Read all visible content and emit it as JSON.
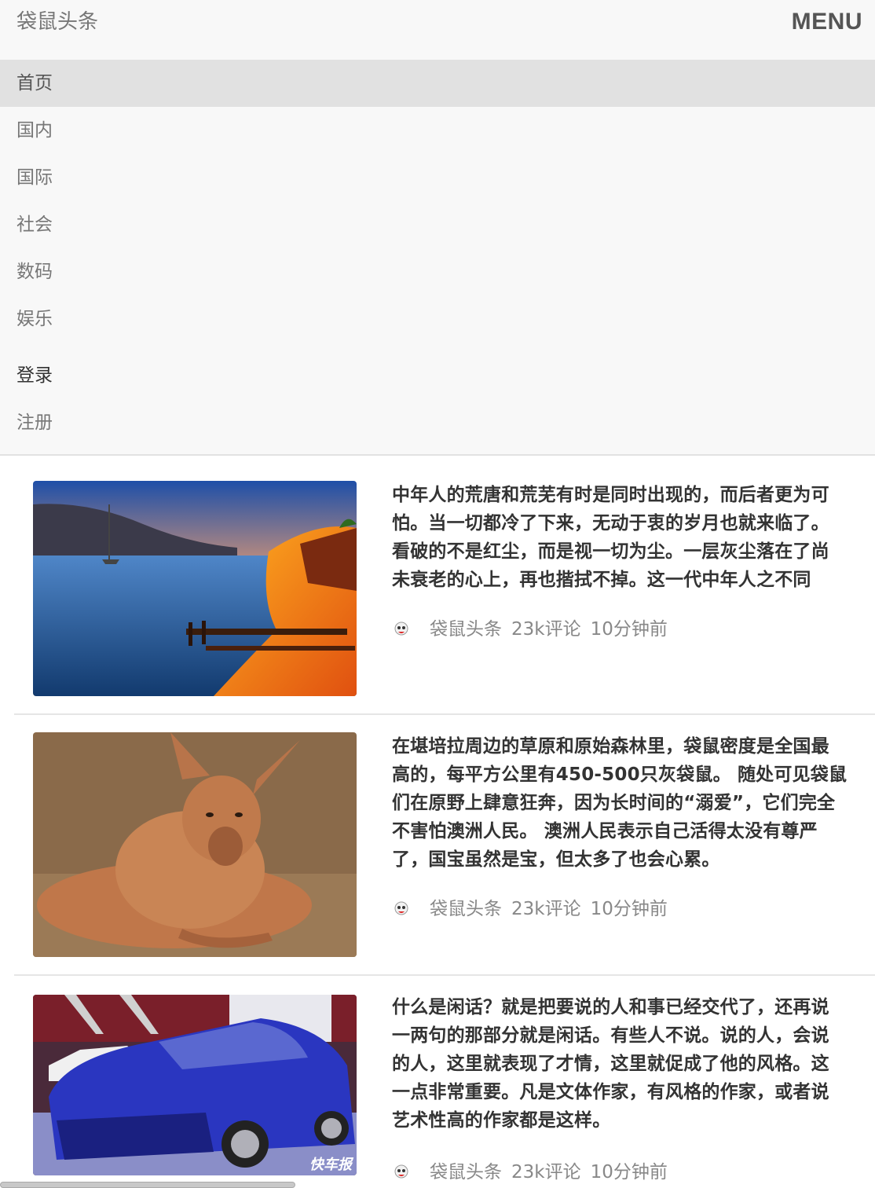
{
  "brand": "袋鼠头条",
  "menu_label": "MENU",
  "nav": {
    "items": [
      "首页",
      "国内",
      "国际",
      "社会",
      "数码",
      "娱乐"
    ],
    "login": "登录",
    "register": "注册"
  },
  "articles": [
    {
      "lines": [
        "中年人的荒唐和荒芜有时是同时出现的，而后者更为可",
        "怕。当一切都冷了下来，无动于衷的岁月也就来临了。",
        "看破的不是红尘，而是视一切为尘。一层灰尘落在了尚",
        "未衰老的心上，再也揩拭不掉。这一代中年人之不同"
      ],
      "source": "袋鼠头条",
      "comments": "23k评论",
      "time": "10分钟前"
    },
    {
      "lines": [
        "在堪培拉周边的草原和原始森林里，袋鼠密度是全国最",
        "高的，每平方公里有450-500只灰袋鼠。 随处可见袋鼠",
        "们在原野上肆意狂奔，因为长时间的“溺爱”，它们完全",
        "不害怕澳洲人民。 澳洲人民表示自己活得太没有尊严",
        "了，国宝虽然是宝，但太多了也会心累。"
      ],
      "source": "袋鼠头条",
      "comments": "23k评论",
      "time": "10分钟前"
    },
    {
      "lines": [
        "什么是闲话？就是把要说的人和事已经交代了，还再说",
        "一两句的那部分就是闲话。有些人不说。说的人，会说",
        "的人，这里就表现了才情，这里就促成了他的风格。这",
        "一点非常重要。凡是文体作家，有风格的作家，或者说",
        "艺术性高的作家都是这样。"
      ],
      "source": "袋鼠头条",
      "comments": "23k评论",
      "time": "10分钟前",
      "image_watermark": "快车报"
    }
  ]
}
